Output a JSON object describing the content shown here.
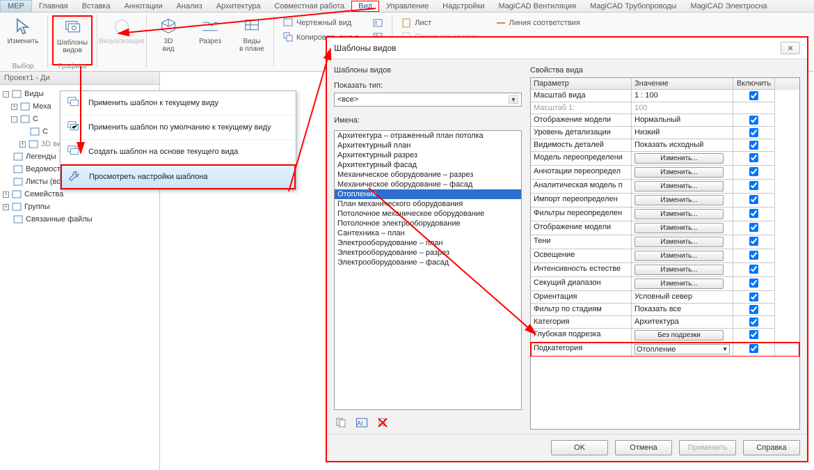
{
  "menu": {
    "mep": "МЕР",
    "items": [
      "Главная",
      "Вставка",
      "Аннотации",
      "Анализ",
      "Архитектура",
      "Совместная работа",
      "Вид",
      "Управление",
      "Надстройки",
      "MagiCAD Вентиляция",
      "MagiCAD Трубопроводы",
      "MagiCAD Электроснa"
    ]
  },
  "ribbon": {
    "edit": "Изменить",
    "select_label": "Выбор",
    "view_templates": "Шаблоны\nвидов",
    "visualize": "Визуализация",
    "view3d": "3D\nвид",
    "section": "Разрез",
    "planviews": "Виды\nв плане",
    "graphics_label": "Графика",
    "draft_view": "Чертежный вид",
    "copy_view": "Копировать вид ▾",
    "sheet": "Лист",
    "title_block": "Основная надпись",
    "match_line": "Линия соответствия"
  },
  "tree": {
    "tab": "Проект1 - Ди",
    "items": [
      {
        "lvl": 0,
        "exp": "-",
        "label": "Виды"
      },
      {
        "lvl": 1,
        "exp": "+",
        "label": "Меха"
      },
      {
        "lvl": 1,
        "exp": "-",
        "label": "С"
      },
      {
        "lvl": 2,
        "exp": "",
        "label": "С"
      },
      {
        "lvl": 2,
        "exp": "+",
        "label": "3D виды",
        "muted": true
      },
      {
        "lvl": 0,
        "exp": "",
        "label": "Легенды"
      },
      {
        "lvl": 0,
        "exp": "",
        "label": "Ведомости/Спецификации"
      },
      {
        "lvl": 0,
        "exp": "",
        "label": "Листы (все)"
      },
      {
        "lvl": 0,
        "exp": "+",
        "label": "Семейства"
      },
      {
        "lvl": 0,
        "exp": "+",
        "label": "Группы"
      },
      {
        "lvl": 0,
        "exp": "",
        "label": "Связанные файлы"
      }
    ]
  },
  "floatmenu": {
    "items": [
      "Применить шаблон к текущему виду",
      "Применить шаблон по умолчанию к текущему виду",
      "Создать шаблон на основе текущего вида",
      "Просмотреть настройки шаблона"
    ]
  },
  "dialog": {
    "title": "Шаблоны видов",
    "left_group": "Шаблоны видов",
    "show_type": "Показать тип:",
    "type_all": "<все>",
    "names_label": "Имена:",
    "names": [
      "Архитектура – отраженный план потолка",
      "Архитектурный план",
      "Архитектурный разрез",
      "Архитектурный фасад",
      "Механическое оборудование – разрез",
      "Механическое оборудование – фасад",
      "Отопление",
      "План механического оборудования",
      "Потолочное механическое оборудование",
      "Потолочное электрооборудование",
      "Сантехника – план",
      "Электрооборудование – план",
      "Электрооборудование – разрез",
      "Электрооборудование – фасад"
    ],
    "right_group": "Свойства вида",
    "head": {
      "p": "Параметр",
      "v": "Значение",
      "i": "Включить"
    },
    "rows": [
      {
        "p": "Масштаб вида",
        "v": "1 : 100",
        "btn": false,
        "chk": true
      },
      {
        "p": "Масштаб  1:",
        "v": "100",
        "btn": false,
        "chk": null,
        "dis": true
      },
      {
        "p": "Отображение модели",
        "v": "Нормальный",
        "btn": false,
        "chk": true
      },
      {
        "p": "Уровень детализации",
        "v": "Низкий",
        "btn": false,
        "chk": true
      },
      {
        "p": "Видимость деталей",
        "v": "Показать исходный",
        "btn": false,
        "chk": true
      },
      {
        "p": "Модель переопределени",
        "v": "Изменить...",
        "btn": true,
        "chk": true
      },
      {
        "p": "Аннотации переопредел",
        "v": "Изменить...",
        "btn": true,
        "chk": true
      },
      {
        "p": "Аналитическая модель п",
        "v": "Изменить...",
        "btn": true,
        "chk": true
      },
      {
        "p": "Импорт переопределен",
        "v": "Изменить...",
        "btn": true,
        "chk": true
      },
      {
        "p": "Фильтры переопределен",
        "v": "Изменить...",
        "btn": true,
        "chk": true
      },
      {
        "p": "Отображение модели",
        "v": "Изменить...",
        "btn": true,
        "chk": true
      },
      {
        "p": "Тени",
        "v": "Изменить...",
        "btn": true,
        "chk": true
      },
      {
        "p": "Освещение",
        "v": "Изменить...",
        "btn": true,
        "chk": true
      },
      {
        "p": "Интенсивность естестве",
        "v": "Изменить...",
        "btn": true,
        "chk": true
      },
      {
        "p": "Секущий диапазон",
        "v": "Изменить...",
        "btn": true,
        "chk": true
      },
      {
        "p": "Ориентация",
        "v": "Условный север",
        "btn": false,
        "chk": true
      },
      {
        "p": "Фильтр по стадиям",
        "v": "Показать все",
        "btn": false,
        "chk": true
      },
      {
        "p": "Категория",
        "v": "Архитектура",
        "btn": false,
        "chk": true
      },
      {
        "p": "Глубокая подрезка",
        "v": "Без подрезки",
        "btn": true,
        "chk": true
      },
      {
        "p": "Подкатегория",
        "v": "Отопление",
        "btn": false,
        "chk": true,
        "combo": true,
        "hi": true
      }
    ],
    "btns": {
      "ok": "OK",
      "cancel": "Отмена",
      "apply": "Применить",
      "help": "Справка"
    }
  }
}
